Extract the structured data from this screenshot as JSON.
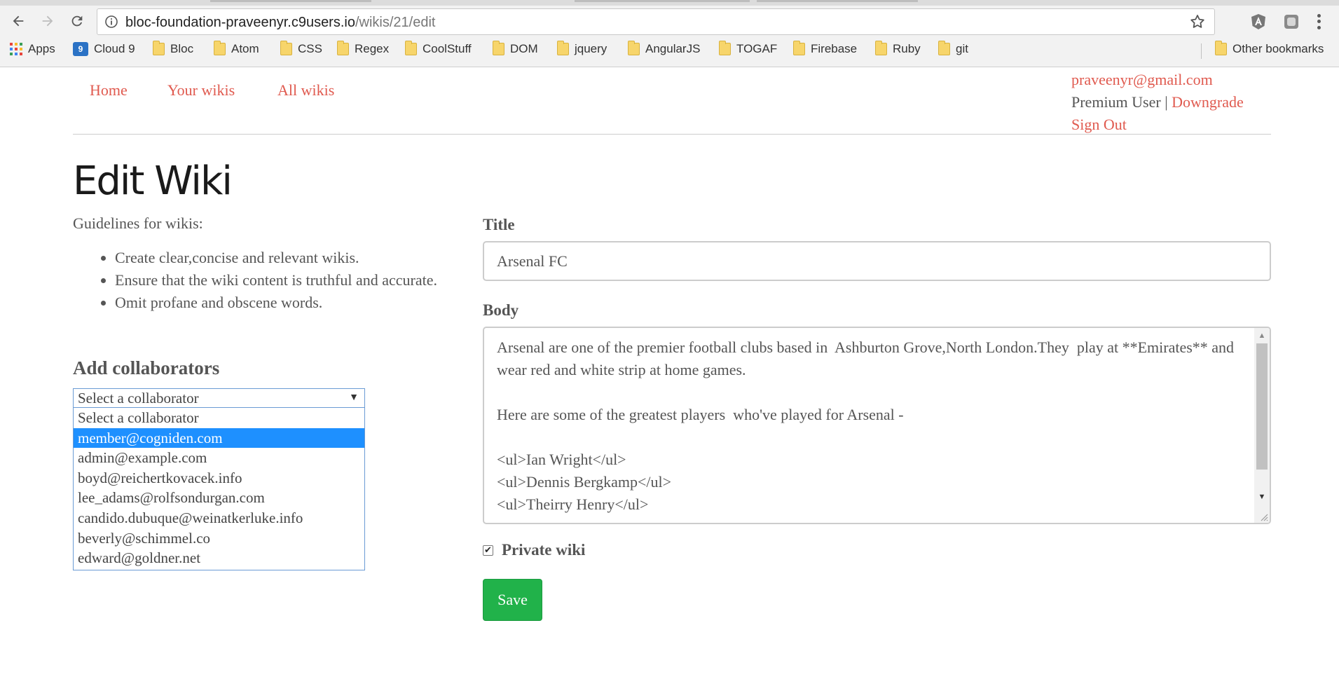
{
  "browser": {
    "url_host": "bloc-foundation-praveenyr.c9users.io",
    "url_path": "/wikis/21/edit",
    "icons": [
      "back-arrow-icon",
      "forward-arrow-icon",
      "reload-icon",
      "info-icon",
      "star-icon",
      "extension-icon",
      "menu-icon"
    ],
    "bookmarks": {
      "apps": "Apps",
      "cloud9": "Cloud 9",
      "bloc": "Bloc",
      "atom": "Atom",
      "css": "CSS",
      "regex": "Regex",
      "coolstuff": "CoolStuff",
      "dom": "DOM",
      "jquery": "jquery",
      "angularjs": "AngularJS",
      "togaf": "TOGAF",
      "firebase": "Firebase",
      "ruby": "Ruby",
      "git": "git",
      "other": "Other bookmarks"
    }
  },
  "nav": {
    "home": "Home",
    "your_wikis": "Your wikis",
    "all_wikis": "All wikis",
    "email": "praveenyr@gmail.com",
    "role": "Premium User",
    "separator": "|",
    "downgrade": "Downgrade",
    "sign_out": "Sign Out"
  },
  "page": {
    "title": "Edit Wiki",
    "guidelines_label": "Guidelines for wikis:",
    "guidelines": [
      "Create clear,concise and relevant wikis.",
      "Ensure that the wiki content is truthful and accurate.",
      "Omit profane and obscene words."
    ]
  },
  "collaborators": {
    "title": "Add collaborators",
    "selected": "Select a collaborator",
    "highlighted_index": 1,
    "options": [
      "Select a collaborator",
      "member@cogniden.com",
      "admin@example.com",
      "boyd@reichertkovacek.info",
      "lee_adams@rolfsondurgan.com",
      "candido.dubuque@weinatkerluke.info",
      "beverly@schimmel.co",
      "edward@goldner.net"
    ]
  },
  "form": {
    "title_label": "Title",
    "title_value": "Arsenal FC",
    "body_label": "Body",
    "body_value": "Arsenal are one of the premier football clubs based in  Ashburton Grove,North London.They  play at **Emirates** and wear red and white strip at home games.\n\nHere are some of the greatest players  who've played for Arsenal -\n\n<ul>Ian Wright</ul>\n<ul>Dennis Bergkamp</ul>\n<ul>Theirry Henry</ul>",
    "private_checked": true,
    "private_label": "Private wiki",
    "save_label": "Save"
  },
  "colors": {
    "link": "#e05a4f",
    "save_button": "#21b24a",
    "select_highlight": "#1e90ff"
  }
}
